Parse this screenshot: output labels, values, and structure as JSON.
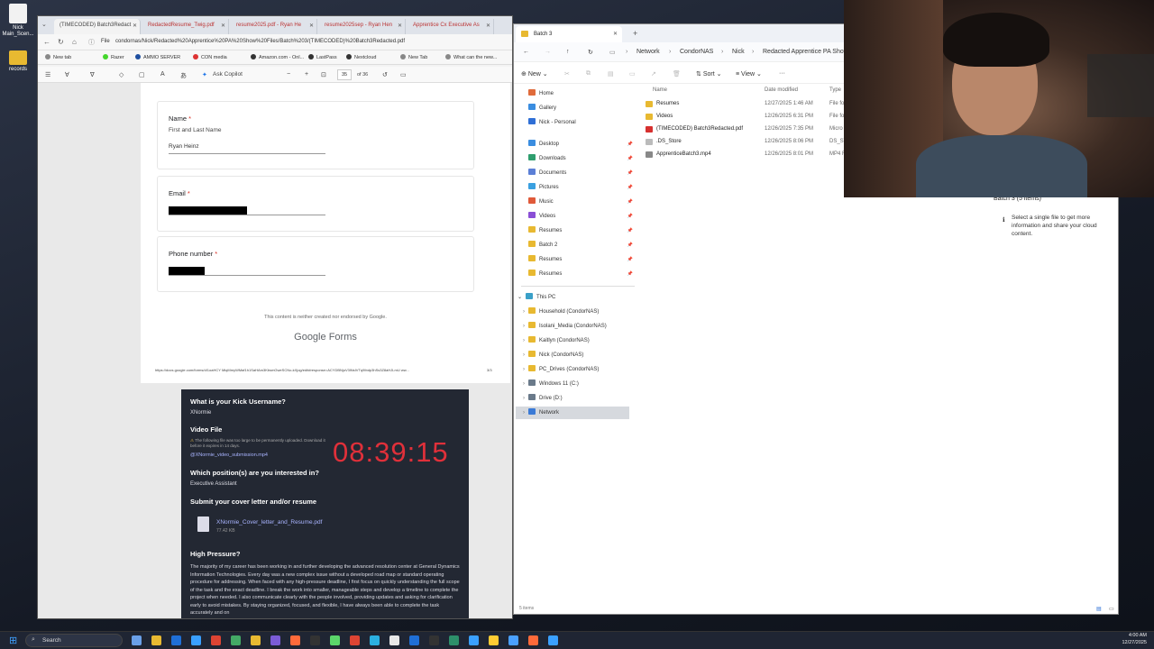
{
  "desktop": {
    "icons": [
      {
        "label": "Nick Main_Scen..."
      },
      {
        "label": "records"
      }
    ]
  },
  "browser": {
    "tabs": [
      {
        "label": "(TIMECODED) Batch3Redact"
      },
      {
        "label": "RedactedResume_Twig.pdf"
      },
      {
        "label": "resume2025.pdf - Ryan He"
      },
      {
        "label": "resume2025sep - Ryan Hen"
      },
      {
        "label": "Apprentice Cx Executive As"
      }
    ],
    "url_prefix": "File",
    "url": "condornas/Nick/Redacted%20Apprentice%20PA%20Show%20Files/Batch%203/(TIMECODED)%20Batch3Redacted.pdf",
    "favorites": [
      {
        "label": "New tab",
        "color": "#888"
      },
      {
        "label": "Razer",
        "color": "#44d62c"
      },
      {
        "label": "AMMO SERVER",
        "color": "#1e4fa0"
      },
      {
        "label": "CON media",
        "color": "#d33"
      },
      {
        "label": "Amazon.com - Onl...",
        "color": "#333"
      },
      {
        "label": "LastPass",
        "color": "#333"
      },
      {
        "label": "Nextcloud",
        "color": "#333"
      },
      {
        "label": "New Tab",
        "color": "#888"
      },
      {
        "label": "What can the new...",
        "color": "#888"
      }
    ],
    "pdf_toolbar": {
      "ask_copilot": "Ask Copilot",
      "page_current": "35",
      "page_total": "of 36"
    },
    "form": {
      "name_label": "Name",
      "name_sub": "First and Last Name",
      "name_value": "Ryan Heinz",
      "email_label": "Email",
      "phone_label": "Phone number",
      "required_mark": "*",
      "disclaimer": "This content is neither created nor endorsed by Google.",
      "brand_google": "Google",
      "brand_forms": "Forms",
      "footer_url": "https://docs.google.com/forms/d/1oaHCY MiqMmyWMaf1h1SaHAm3KbsmGweSCNo-kXjog/edit#response=ACYDBNjuV3lNsIVTq9Ibdp3hSs3Z8aHJLmU ww...",
      "footer_page": "3/3"
    },
    "submission": {
      "q_username": "What is your Kick Username?",
      "a_username": "XNormie",
      "q_video": "Video File",
      "video_warning": "The following file was too large to be permanently uploaded. Download it before it expires in 14 days.",
      "video_file": "@XNormie_video_submission.mp4",
      "q_position": "Which position(s) are you interested in?",
      "a_position": "Executive Assistant",
      "q_cover": "Submit your cover letter and/or resume",
      "cover_file": "XNormie_Cover_letter_and_Resume.pdf",
      "cover_size": "77.42 KB",
      "q_pressure": "High Pressure?",
      "a_pressure": "The majority of my career has been working in and further developing the advanced resolution center at General Dynamics Information Technologies. Every day was a new complex issue without a developed road map or standard operating procedure for addressing. When faced with any high-pressure deadline, I first focus on quickly understanding the full scope of the task and the exact deadline. I break the work into smaller, manageable steps and develop a timeline to complete the project when needed. I also communicate clearly with the people involved, providing updates and asking for clarification early to avoid mistakes. By staying organized, focused, and flexible, I have always been able to complete the task accurately and on",
      "timer": "08:39:15"
    }
  },
  "explorer": {
    "tab_title": "Batch 3",
    "breadcrumb": [
      "Network",
      "CondorNAS",
      "Nick",
      "Redacted Apprentice PA Show"
    ],
    "commands": {
      "new": "New",
      "sort": "Sort",
      "view": "View"
    },
    "quick_access": [
      {
        "label": "Home",
        "color": "#e06b3b",
        "pinned": false
      },
      {
        "label": "Gallery",
        "color": "#3a8de0",
        "pinned": false
      },
      {
        "label": "Nick - Personal",
        "color": "#2f6fd6",
        "pinned": false
      },
      {
        "label": "Desktop",
        "color": "#3a8de0",
        "pinned": true
      },
      {
        "label": "Downloads",
        "color": "#2f9e6e",
        "pinned": true
      },
      {
        "label": "Documents",
        "color": "#5b7fd6",
        "pinned": true
      },
      {
        "label": "Pictures",
        "color": "#3aa0e0",
        "pinned": true
      },
      {
        "label": "Music",
        "color": "#e05a3a",
        "pinned": true
      },
      {
        "label": "Videos",
        "color": "#8a4fd6",
        "pinned": true
      },
      {
        "label": "Resumes",
        "color": "#e8b931",
        "pinned": true
      },
      {
        "label": "Batch 2",
        "color": "#e8b931",
        "pinned": true
      },
      {
        "label": "Resumes",
        "color": "#e8b931",
        "pinned": true
      },
      {
        "label": "Resumes",
        "color": "#e8b931",
        "pinned": true
      }
    ],
    "this_pc": {
      "label": "This PC",
      "items": [
        {
          "label": "Household (CondorNAS)",
          "color": "#e8b931"
        },
        {
          "label": "Isolani_Media (CondorNAS)",
          "color": "#e8b931"
        },
        {
          "label": "Kaitlyn (CondorNAS)",
          "color": "#e8b931"
        },
        {
          "label": "Nick (CondorNAS)",
          "color": "#e8b931"
        },
        {
          "label": "PC_Drives (CondorNAS)",
          "color": "#e8b931"
        },
        {
          "label": "Windows 11 (C:)",
          "color": "#6a7a8a"
        },
        {
          "label": "Drive (D:)",
          "color": "#6a7a8a"
        },
        {
          "label": "Network",
          "color": "#3a7ad6"
        }
      ]
    },
    "columns": {
      "name": "Name",
      "date": "Date modified",
      "type": "Type"
    },
    "files": [
      {
        "name": "Resumes",
        "date": "12/27/2025 1:46 AM",
        "type": "File fo",
        "color": "#e8b931"
      },
      {
        "name": "Videos",
        "date": "12/26/2025 6:31 PM",
        "type": "File fo",
        "color": "#e8b931"
      },
      {
        "name": "(TIMECODED) Batch3Redacted.pdf",
        "date": "12/26/2025 7:35 PM",
        "type": "Micro",
        "color": "#d6302f"
      },
      {
        "name": ".DS_Store",
        "date": "12/26/2025 8:06 PM",
        "type": "DS_ST",
        "color": "#bbbbbb"
      },
      {
        "name": "ApprenticeBatch3.mp4",
        "date": "12/26/2025 8:01 PM",
        "type": "MP4 F",
        "color": "#888888"
      }
    ],
    "details_title": "Batch 3 (5 items)",
    "details_text": "Select a single file to get more information and share your cloud content.",
    "status": "5 items"
  },
  "taskbar": {
    "search": "Search",
    "time": "4:00 AM",
    "date": "12/27/2025"
  }
}
